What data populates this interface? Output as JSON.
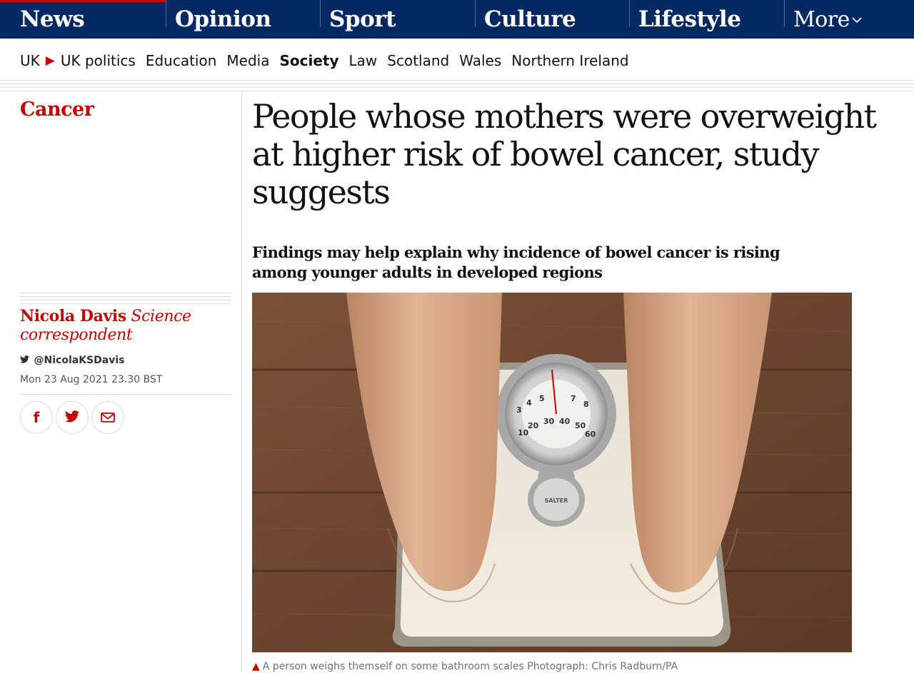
{
  "nav": {
    "pillars": [
      "News",
      "Opinion",
      "Sport",
      "Culture",
      "Lifestyle"
    ],
    "more_label": "More",
    "active": "News"
  },
  "subnav": {
    "items": [
      "UK",
      "UK politics",
      "Education",
      "Media",
      "Society",
      "Law",
      "Scotland",
      "Wales",
      "Northern Ireland"
    ],
    "active": "Society"
  },
  "article": {
    "kicker": "Cancer",
    "headline": "People whose mothers were overweight at higher risk of bowel cancer, study suggests",
    "standfirst": "Findings may help explain why incidence of bowel cancer is rising among younger adults in developed regions",
    "author_name": "Nicola Davis",
    "author_role": "Science correspondent",
    "twitter": "@NicolaKSDavis",
    "date": "Mon 23 Aug 2021 23.30 BST",
    "caption": "A person weighs themself on some bathroom scales Photograph: Chris Radburn/PA",
    "scale_brand": "SALTER"
  },
  "share": {
    "facebook_icon": "f",
    "twitter_icon": "twitter-bird",
    "email_icon": "envelope"
  },
  "colors": {
    "brand_blue": "#052962",
    "news_red": "#c70000"
  }
}
